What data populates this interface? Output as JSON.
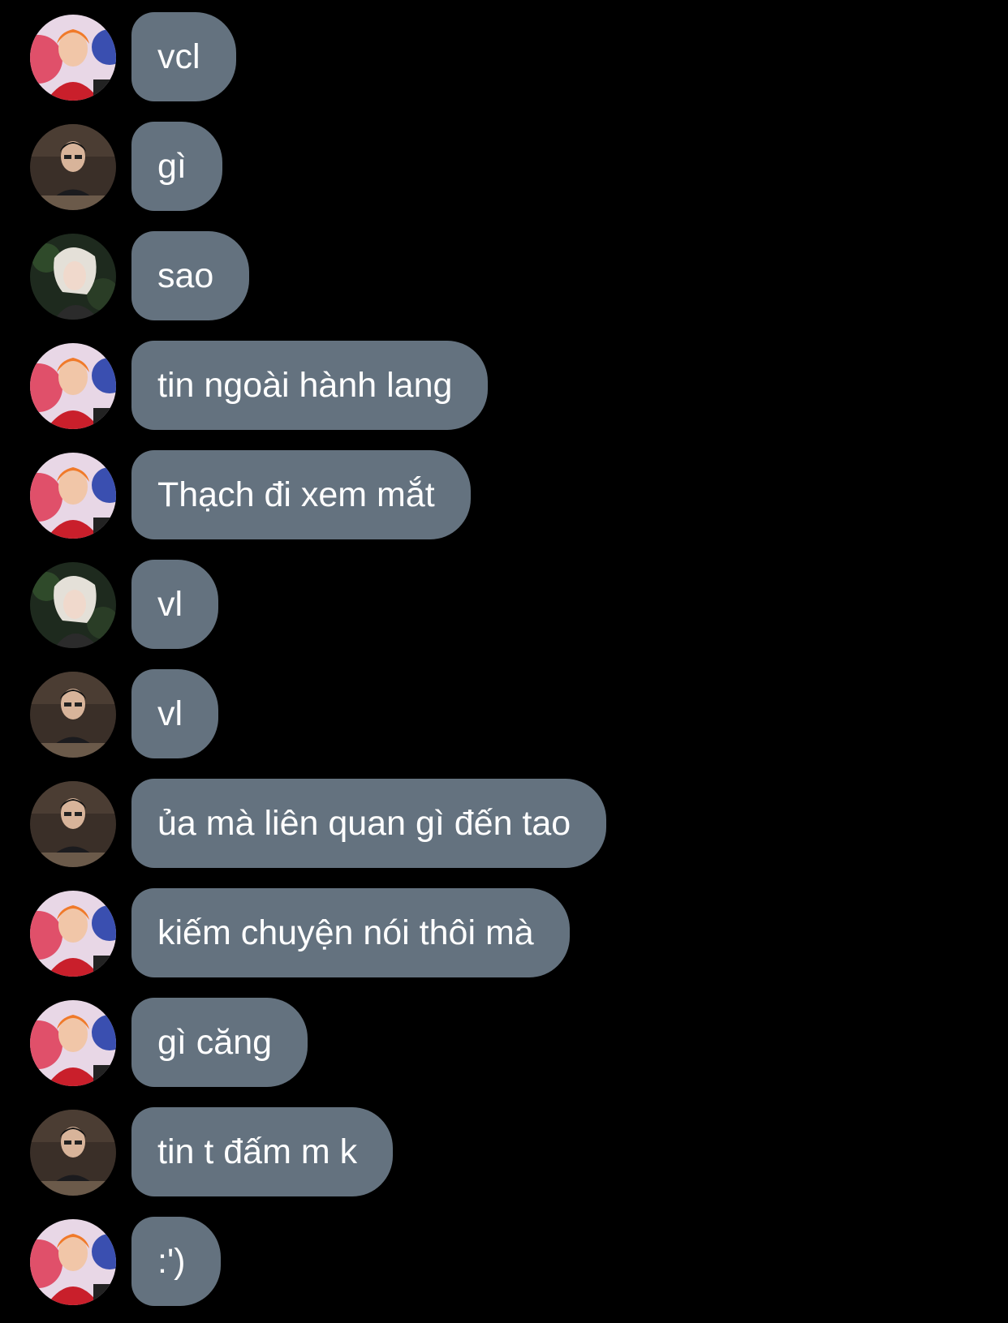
{
  "avatars": {
    "a": {
      "name": "avatar-orange-hair",
      "icon": "avatar-orange-hair-person"
    },
    "b": {
      "name": "avatar-dark-glasses",
      "icon": "avatar-dark-glasses-person"
    },
    "c": {
      "name": "avatar-white-hair",
      "icon": "avatar-white-hair-person"
    }
  },
  "colors": {
    "background": "#000000",
    "bubble": "#64727f",
    "text": "#ffffff"
  },
  "messages": [
    {
      "sender": "a",
      "text": "vcl"
    },
    {
      "sender": "b",
      "text": "gì"
    },
    {
      "sender": "c",
      "text": "sao"
    },
    {
      "sender": "a",
      "text": "tin ngoài hành lang"
    },
    {
      "sender": "a",
      "text": "Thạch đi xem mắt"
    },
    {
      "sender": "c",
      "text": "vl"
    },
    {
      "sender": "b",
      "text": "vl"
    },
    {
      "sender": "b",
      "text": "ủa mà liên quan gì đến tao"
    },
    {
      "sender": "a",
      "text": "kiếm chuyện nói thôi mà"
    },
    {
      "sender": "a",
      "text": "gì căng"
    },
    {
      "sender": "b",
      "text": "tin t đấm m k"
    },
    {
      "sender": "a",
      "text": ":')"
    }
  ]
}
